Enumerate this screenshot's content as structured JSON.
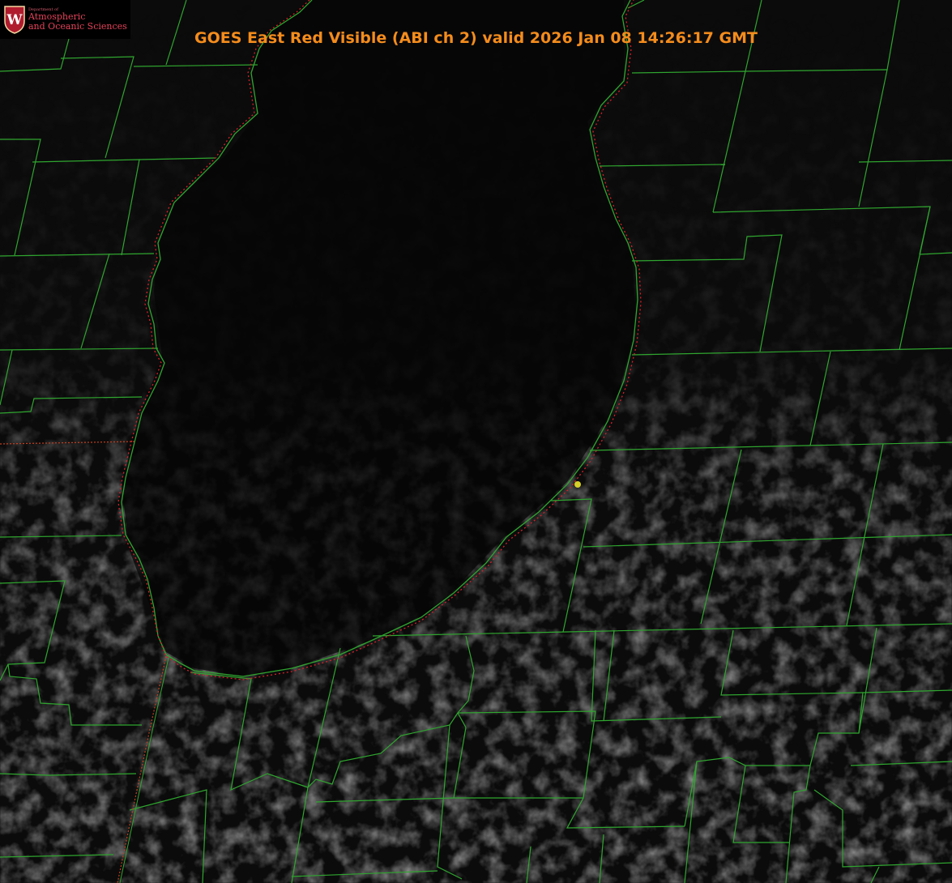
{
  "logo": {
    "dept": "Department of",
    "line1": "Atmospheric",
    "line2": "and Oceanic Sciences",
    "seal_letter": "W",
    "icon": "uw-crest-icon",
    "color": "#e6425a"
  },
  "title": "GOES East Red Visible (ABI ch 2) valid 2026 Jan 08 14:26:17 GMT",
  "colors": {
    "background": "#000000",
    "county_lines": "#2fa52f",
    "lake_outline": "#d8202a",
    "title": "#f48c1c",
    "marker": "#d6d028"
  },
  "layers": [
    "county-boundaries",
    "lake-shoreline",
    "state-border",
    "cloud-field",
    "location-marker"
  ]
}
